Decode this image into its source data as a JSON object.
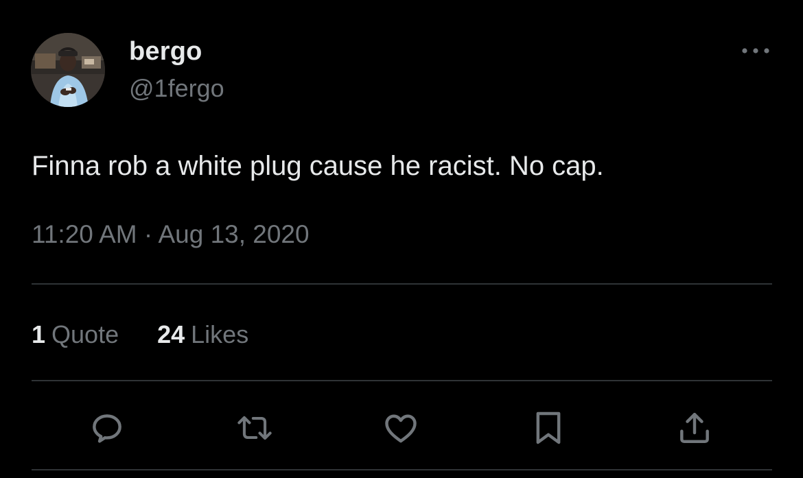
{
  "author": {
    "display_name": "bergo",
    "handle": "@1fergo"
  },
  "tweet": {
    "text": "Finna rob a white plug cause he racist. No cap.",
    "time": "11:20 AM",
    "separator": "·",
    "date": "Aug 13, 2020"
  },
  "stats": {
    "quotes_count": "1",
    "quotes_label": "Quote",
    "likes_count": "24",
    "likes_label": "Likes"
  },
  "actions": [
    "reply-icon",
    "retweet-icon",
    "like-icon",
    "bookmark-icon",
    "share-icon"
  ],
  "colors": {
    "background": "#000000",
    "primary_text": "#e7e9ea",
    "secondary_text": "#71767b",
    "divider": "#2f3336"
  }
}
